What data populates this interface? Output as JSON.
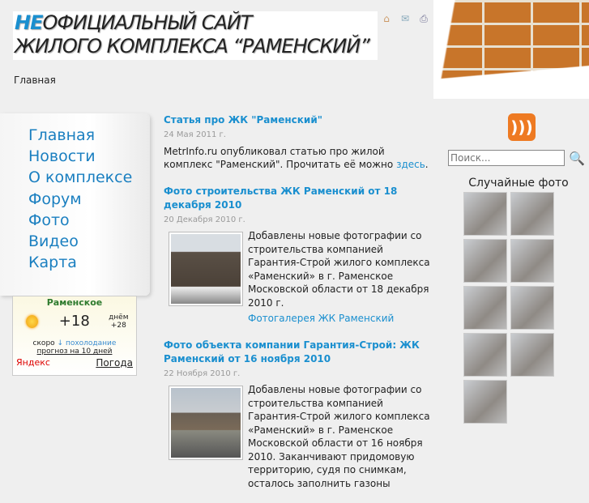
{
  "header": {
    "logo_highlight": "НЕ",
    "logo_line1": "ОФИЦИАЛЬНЫЙ САЙТ",
    "logo_line2": "ЖИЛОГО КОМПЛЕКСА “РАМЕНСКИЙ”",
    "icons": [
      "home-icon",
      "mail-icon",
      "print-icon"
    ]
  },
  "breadcrumb": "Главная",
  "nav": [
    "Главная",
    "Новости",
    "О комплексе",
    "Форум",
    "Фото",
    "Видео",
    "Карта"
  ],
  "weather": {
    "city": "Раменское",
    "temp": "+18",
    "day": "днём +28",
    "soon": "скоро",
    "soon_trend": "↓ похолодание",
    "forecast": "прогноз на 10 дней",
    "brand": "Яндекс",
    "link": "Погода"
  },
  "posts": [
    {
      "title": "Статья про ЖК \"Раменский\"",
      "date": "24 Мая 2011 г.",
      "text": "MetrInfo.ru опубликовал статью про жилой комплекс \"Раменский\". Прочитать её можно ",
      "link": "здесь",
      "after": "."
    },
    {
      "title": "Фото строительства ЖК Раменский от 18 декабря 2010",
      "date": "20 Декабря 2010 г.",
      "text": "Добавлены новые фотографии со строительства компанией Гарантия-Строй жилого комплекса «Раменский» в г. Раменское Московской области от 18 декабря 2010 г.",
      "link": "Фотогалерея ЖК Раменский"
    },
    {
      "title": "Фото объекта компании Гарантия-Строй: ЖК Раменский от 16 ноября 2010",
      "date": "22 Ноября 2010 г.",
      "text": "Добавлены новые фотографии со строительства компанией Гарантия-Строй жилого комплекса «Раменский» в г. Раменское Московской области от 16 ноября 2010. Заканчивают придомовую территорию, судя по снимкам, осталось заполнить газоны"
    }
  ],
  "sidebar": {
    "rss": "RSS",
    "search_placeholder": "Поиск...",
    "random_title": "Случайные фото",
    "photo_count": 9
  }
}
